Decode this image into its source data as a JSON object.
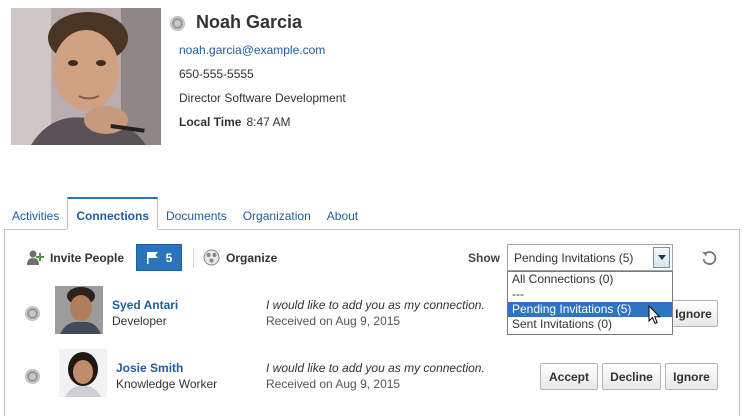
{
  "profile": {
    "name": "Noah Garcia",
    "email": "noah.garcia@example.com",
    "phone": "650-555-5555",
    "title": "Director Software Development",
    "local_time_label": "Local Time",
    "local_time_value": "8:47 AM"
  },
  "tabs": [
    {
      "label": "Activities",
      "active": false
    },
    {
      "label": "Connections",
      "active": true
    },
    {
      "label": "Documents",
      "active": false
    },
    {
      "label": "Organization",
      "active": false
    },
    {
      "label": "About",
      "active": false
    }
  ],
  "toolbar": {
    "invite_label": "Invite People",
    "flag_count": "5",
    "organize_label": "Organize",
    "show_label": "Show",
    "show_selected": "Pending Invitations (5)"
  },
  "dropdown": {
    "options": [
      "All Connections (0)",
      "---",
      "Pending Invitations (5)",
      "Sent Invitations (0)"
    ],
    "selected_index": 2
  },
  "invitations": [
    {
      "name": "Syed Antari",
      "role": "Developer",
      "message": "I would like to add you as my connection.",
      "received": "Received on Aug 9, 2015",
      "ignore_label": "Ignore"
    },
    {
      "name": "Josie Smith",
      "role": "Knowledge Worker",
      "message": "I would like to add you as my connection.",
      "received": "Received on Aug 9, 2015",
      "accept_label": "Accept",
      "decline_label": "Decline",
      "ignore_label": "Ignore"
    }
  ],
  "colors": {
    "accent": "#2a73bd",
    "link": "#1f5c9e",
    "dropdown_highlight": "#2f74c4"
  }
}
